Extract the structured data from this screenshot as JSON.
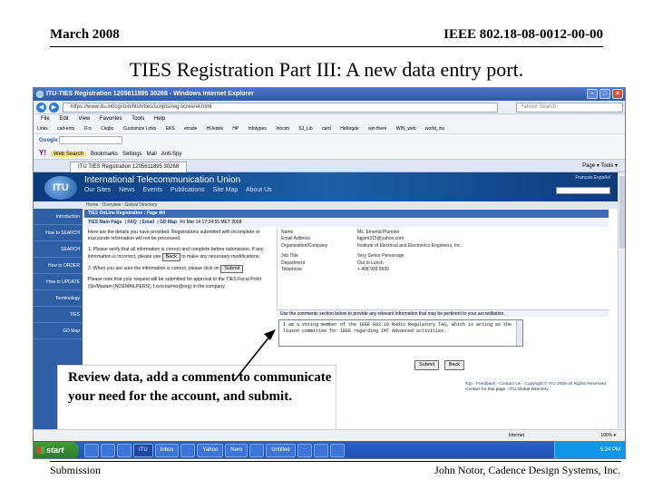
{
  "slide": {
    "header_left": "March 2008",
    "header_right": "IEEE 802.18-08-0012-00-00",
    "title": "TIES Registration Part III: A new data entry port.",
    "footer_left": "Submission",
    "footer_right": "John Notor, Cadence Design Systems, Inc.",
    "callout": "Review data, add a comment to communicate your need for the account, and submit."
  },
  "browser": {
    "window_title": "ITU-TIES Registration 1205611895 30268 - Windows Internet Explorer",
    "url": "https://www.itu.int/cgi-bin/htsh/ties/scripts/reg.screen4.html",
    "search_placeholder": "Yahoo! Search",
    "menu": [
      "File",
      "Edit",
      "View",
      "Favorites",
      "Tools",
      "Help"
    ],
    "links": [
      "Links",
      "cad-ents",
      "O:o",
      "Ckqbc",
      "Customize Links",
      "EKS",
      "etrade",
      "HUedek",
      "HP",
      "Infotypes",
      "Inocim",
      "SJ_Lib",
      "card",
      "Haforgde",
      "win there",
      "WIN_web",
      "world_ins"
    ],
    "google_label": "Google",
    "yahoo_label": "Y!",
    "yahoo_items": [
      "Web Search",
      "Bookmarks",
      "Settings",
      "Mail",
      "Anti-Spy"
    ],
    "tab_label": "ITU TIES Registration 1205611895 30268",
    "tab_tools": "Page ▾  Tools ▾",
    "status_zone": "Internet",
    "zoom": "100% ▾"
  },
  "site": {
    "org_name": "International Telecommunication Union",
    "nav": [
      "Our Sites",
      "News",
      "Events",
      "Publications",
      "Site Map",
      "About Us"
    ],
    "languages": "Français Español",
    "breadcrumb": "Home : Overview : Global Directory",
    "leftnav": [
      "Introduction",
      "How to SEARCH",
      "SEARCH",
      "How to ORDER",
      "How to UPDATE",
      "Terminology",
      "TIES",
      "GD Map"
    ],
    "box_title": "TIES OnLine Registration : Page 4/4",
    "box_links": {
      "main": "TIES Main Page",
      "faq": "FAQ",
      "email": "Email",
      "gdmap": "GD Map",
      "datetime": "Fri Mar 14 17:24:55 MET 2008"
    },
    "instr1": "Here are the details you have provided. Registrations submitted with incomplete or inaccurate information will not be processed.",
    "instr2": "1. Please verify that all information is correct and complete before submission. If any information is incorrect, please use",
    "back_label": "Back",
    "instr2b": "to make any necessary modifications.",
    "instr3": "2. When you are sure the information is correct, please click on",
    "submit_label": "Submit",
    "instr4": "Please note that your request will be submitted for approval to the TIES Focal Point (Sir/Madam [NOEMAILPERS], f.xxxcourrier@org) in the company.",
    "details": [
      {
        "k": "Name",
        "v": "Ms. Emerita Plumber"
      },
      {
        "k": "Email Address",
        "v": "bgjxm315@yahoo.com"
      },
      {
        "k": "Organization/Company",
        "v": "Institute of Electrical and Electronics Engineers, Inc."
      },
      {
        "k": "Job Title",
        "v": "Very Senior Personage"
      },
      {
        "k": "Department",
        "v": "Out to Lunch"
      },
      {
        "k": "Telephone",
        "v": "+ 408 999 9999"
      }
    ],
    "comments_label": "Use the comments section below to provide any relevant information that may be pertinent to your accreditation.",
    "comment_text": "I am a voting member of the IEEE 802.18 Radio Regulatory TAG, which is acting as the liason committee for IEEE regarding IMT Advanced activities.",
    "form_submit": "Submit",
    "form_back": "Back",
    "footer_line1": "Top - Feedback - Contact Us - Copyright © ITU 2008 All Rights Reserved",
    "footer_line2": "Contact for this page : ITU Global Directory"
  },
  "taskbar": {
    "start": "start",
    "tasks": [
      "",
      "",
      "",
      "ITU",
      "Inbox",
      "",
      "Yahoo",
      "Nero",
      "",
      "Untitled",
      "",
      "",
      ""
    ],
    "tray_time": "5:24 PM"
  }
}
